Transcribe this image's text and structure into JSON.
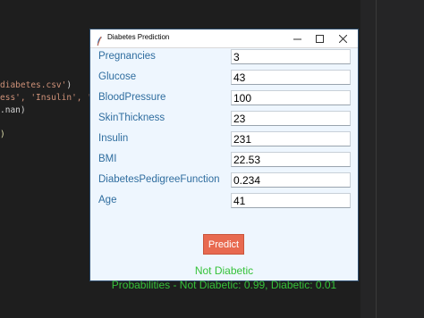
{
  "editor": {
    "lines": [
      {
        "prefix": "",
        "str": "diabetes.csv'",
        "suffix": ")"
      },
      {
        "prefix": "",
        "str": "ess', 'Insulin', 'BMI",
        "suffix": ""
      },
      {
        "prefix": "",
        "str": "",
        "suffix": ".nan)"
      },
      {
        "prefix": "",
        "str": "",
        "suffix": ")"
      }
    ]
  },
  "window": {
    "title": "Diabetes Prediction",
    "controls": {
      "minimize": "—",
      "maximize": "☐",
      "close": "✕"
    }
  },
  "fields": [
    {
      "label": "Pregnancies",
      "value": "3"
    },
    {
      "label": "Glucose",
      "value": "43"
    },
    {
      "label": "BloodPressure",
      "value": "100"
    },
    {
      "label": "SkinThickness",
      "value": "23"
    },
    {
      "label": "Insulin",
      "value": "231"
    },
    {
      "label": "BMI",
      "value": "22.53"
    },
    {
      "label": "DiabetesPedigreeFunction",
      "value": "0.234"
    },
    {
      "label": "Age",
      "value": "41"
    }
  ],
  "predict_label": "Predict",
  "result": {
    "prediction": "Not Diabetic",
    "probabilities": "Probabilities - Not Diabetic: 0.99, Diabetic: 0.01"
  },
  "colors": {
    "label": "#2f6d9f",
    "button": "#e86a50",
    "result": "#35c23a"
  }
}
